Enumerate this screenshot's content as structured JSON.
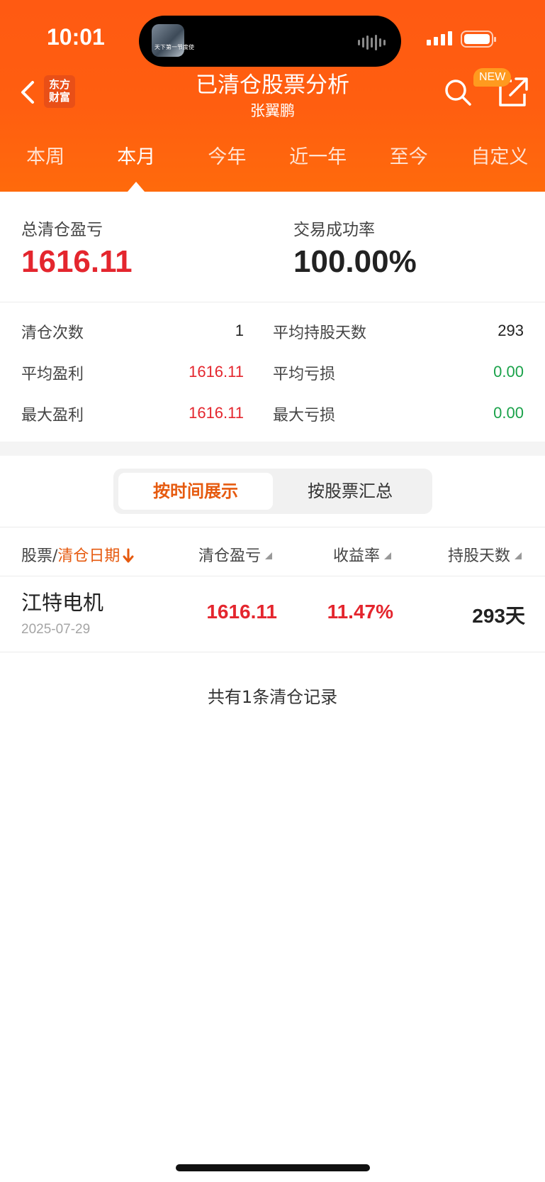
{
  "status_bar": {
    "time": "10:01",
    "island_thumb_text": "天下第一节度使"
  },
  "header": {
    "brand_logo": "东方财富",
    "title": "已清仓股票分析",
    "subtitle": "张翼鹏",
    "new_badge": "NEW",
    "icons": [
      "back-icon",
      "search-icon",
      "share-icon"
    ]
  },
  "tabs": [
    {
      "label": "本周",
      "active": false
    },
    {
      "label": "本月",
      "active": true
    },
    {
      "label": "今年",
      "active": false
    },
    {
      "label": "近一年",
      "active": false
    },
    {
      "label": "至今",
      "active": false
    },
    {
      "label": "自定义",
      "active": false
    }
  ],
  "summary": {
    "total_pl_label": "总清仓盈亏",
    "total_pl_value": "1616.11",
    "success_rate_label": "交易成功率",
    "success_rate_value": "100.00%"
  },
  "stats": {
    "clear_count_label": "清仓次数",
    "clear_count_value": "1",
    "avg_hold_days_label": "平均持股天数",
    "avg_hold_days_value": "293",
    "avg_profit_label": "平均盈利",
    "avg_profit_value": "1616.11",
    "avg_loss_label": "平均亏损",
    "avg_loss_value": "0.00",
    "max_profit_label": "最大盈利",
    "max_profit_value": "1616.11",
    "max_loss_label": "最大亏损",
    "max_loss_value": "0.00"
  },
  "segment": {
    "by_time": "按时间展示",
    "by_stock": "按股票汇总",
    "active": "by_time"
  },
  "table": {
    "col_stock": "股票/",
    "col_date": "清仓日期",
    "col_pl": "清仓盈亏",
    "col_return": "收益率",
    "col_days": "持股天数",
    "rows": [
      {
        "name": "江特电机",
        "date": "2025-07-29",
        "pl": "1616.11",
        "return": "11.47%",
        "days": "293天"
      }
    ]
  },
  "footer_note": "共有1条清仓记录",
  "colors": {
    "header_orange": "#ff5a12",
    "accent_orange": "#e65a0f",
    "profit_red": "#e4262e",
    "loss_green": "#1aa24a"
  }
}
